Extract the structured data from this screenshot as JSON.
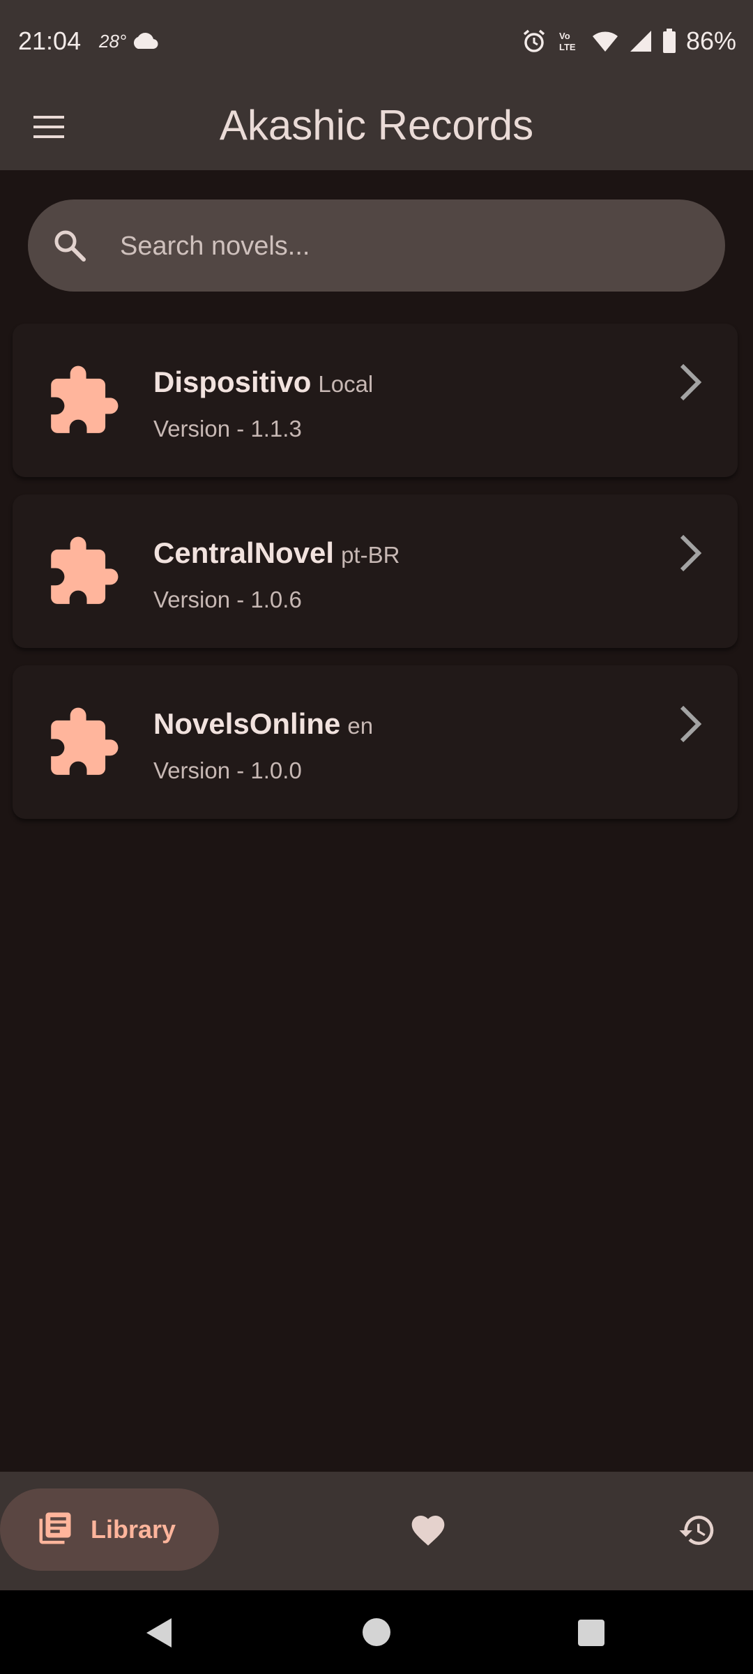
{
  "status_bar": {
    "time": "21:04",
    "temperature": "28°",
    "battery": "86%",
    "icons": [
      "cloud-icon",
      "alarm-icon",
      "volte-icon",
      "wifi-icon",
      "signal-icon",
      "battery-icon"
    ]
  },
  "app_bar": {
    "title": "Akashic Records",
    "menu_icon": "menu-icon"
  },
  "search": {
    "placeholder": "Search novels...",
    "value": ""
  },
  "extensions": [
    {
      "name": "Dispositivo",
      "lang": "Local",
      "version": "Version - 1.1.3"
    },
    {
      "name": "CentralNovel",
      "lang": "pt-BR",
      "version": "Version - 1.0.6"
    },
    {
      "name": "NovelsOnline",
      "lang": "en",
      "version": "Version - 1.0.0"
    }
  ],
  "bottom_nav": {
    "library_label": "Library",
    "items": [
      "library-icon",
      "favorite-icon",
      "history-icon"
    ],
    "active": "Library"
  },
  "colors": {
    "accent": "#ffb59c",
    "background": "#1c1413",
    "surface": "#3c3432",
    "card": "#211918"
  }
}
